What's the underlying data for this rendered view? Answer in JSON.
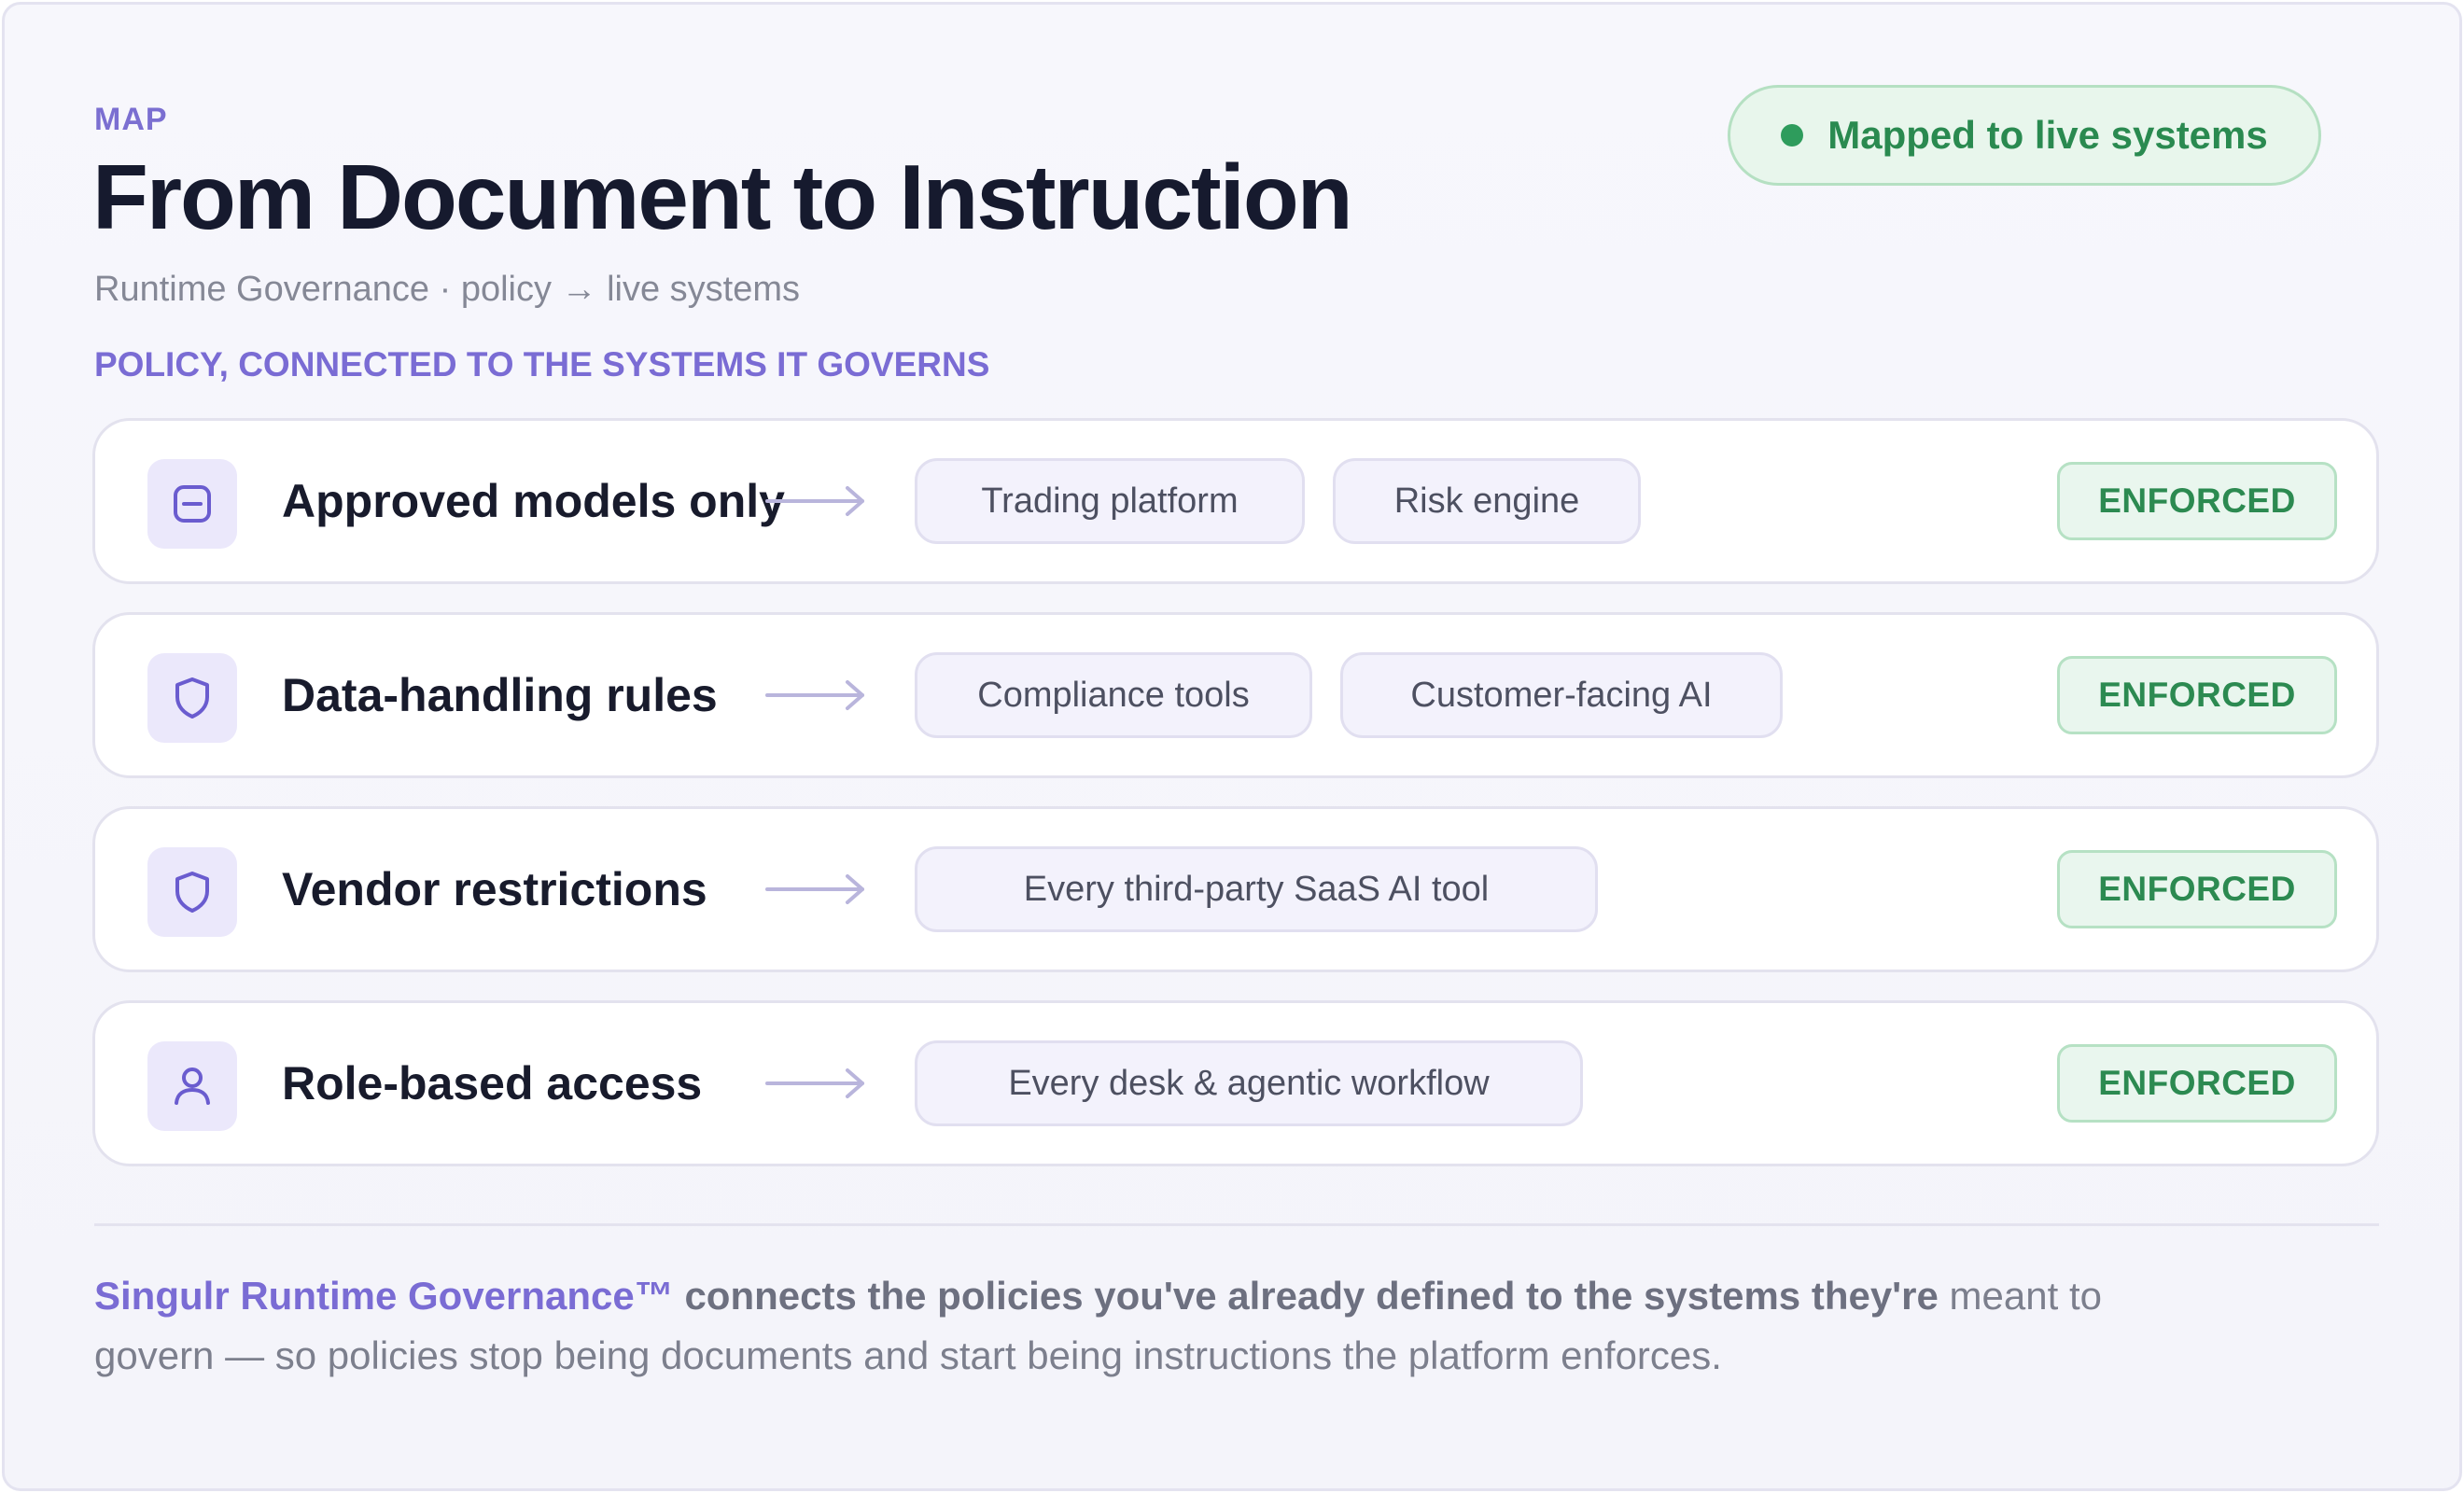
{
  "header": {
    "eyebrow": "MAP",
    "title": "From Document to Instruction",
    "subtitle": "Runtime Governance · policy → live systems",
    "section_label": "POLICY, CONNECTED TO THE SYSTEMS IT GOVERNS"
  },
  "status": {
    "label": "Mapped to live systems",
    "color": "#2e9c5c"
  },
  "policies": [
    {
      "icon": "minus-square-icon",
      "label": "Approved models only",
      "systems": [
        "Trading platform",
        "Risk engine"
      ],
      "status": "ENFORCED"
    },
    {
      "icon": "shield-icon",
      "label": "Data-handling rules",
      "systems": [
        "Compliance tools",
        "Customer-facing AI"
      ],
      "status": "ENFORCED"
    },
    {
      "icon": "shield-icon",
      "label": "Vendor restrictions",
      "systems": [
        "Every third-party SaaS AI tool"
      ],
      "status": "ENFORCED"
    },
    {
      "icon": "user-icon",
      "label": "Role-based access",
      "systems": [
        "Every desk & agentic workflow"
      ],
      "status": "ENFORCED"
    }
  ],
  "footer": {
    "brand": "Singulr Runtime Governance™",
    "strong": " connects the policies you've already defined to the systems they're",
    "rest": " meant to govern — so policies stop being documents and start being instructions the platform enforces."
  },
  "colors": {
    "accent": "#7a6cd4",
    "enforced": "#2c8a51",
    "title": "#161a2e"
  }
}
